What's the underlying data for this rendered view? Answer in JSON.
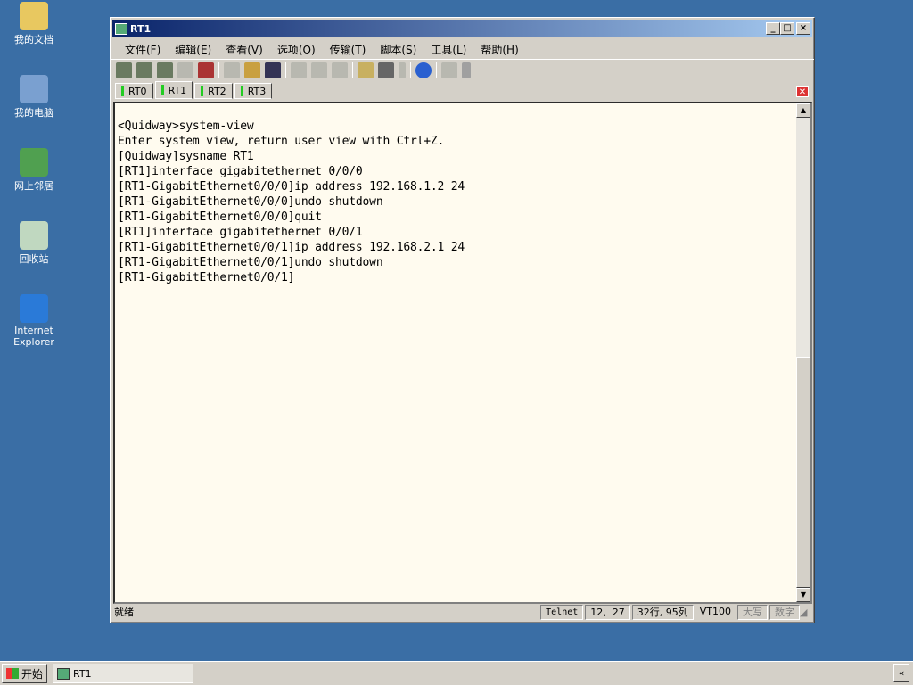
{
  "desktop": {
    "icons": [
      {
        "label": "我的文档",
        "icon": "my-documents-icon",
        "color": "#e8c860"
      },
      {
        "label": "我的电脑",
        "icon": "my-computer-icon",
        "color": "#7aa0d0"
      },
      {
        "label": "网上邻居",
        "icon": "network-icon",
        "color": "#50a050"
      },
      {
        "label": "回收站",
        "icon": "recycle-bin-icon",
        "color": "#c0d8c0"
      },
      {
        "label": "Internet Explorer",
        "icon": "ie-icon",
        "color": "#2a7ad8"
      }
    ]
  },
  "window": {
    "title": "RT1",
    "menu": [
      "文件(F)",
      "编辑(E)",
      "查看(V)",
      "选项(O)",
      "传输(T)",
      "脚本(S)",
      "工具(L)",
      "帮助(H)"
    ],
    "tabs": [
      "RT0",
      "RT1",
      "RT2",
      "RT3"
    ],
    "active_tab": "RT1",
    "terminal_lines": [
      "<Quidway>system-view",
      "Enter system view, return user view with Ctrl+Z.",
      "[Quidway]sysname RT1",
      "[RT1]interface gigabitethernet 0/0/0",
      "[RT1-GigabitEthernet0/0/0]ip address 192.168.1.2 24",
      "[RT1-GigabitEthernet0/0/0]undo shutdown",
      "[RT1-GigabitEthernet0/0/0]quit",
      "[RT1]interface gigabitethernet 0/0/1",
      "[RT1-GigabitEthernet0/0/1]ip address 192.168.2.1 24",
      "[RT1-GigabitEthernet0/0/1]undo shutdown",
      "[RT1-GigabitEthernet0/0/1]"
    ],
    "status": {
      "ready": "就绪",
      "protocol": "Telnet",
      "cursor": "12,  27",
      "size": "32行, 95列",
      "emulation": "VT100",
      "caps": "大写",
      "num": "数字"
    }
  },
  "taskbar": {
    "start": "开始",
    "task": "RT1",
    "tray": "«"
  }
}
